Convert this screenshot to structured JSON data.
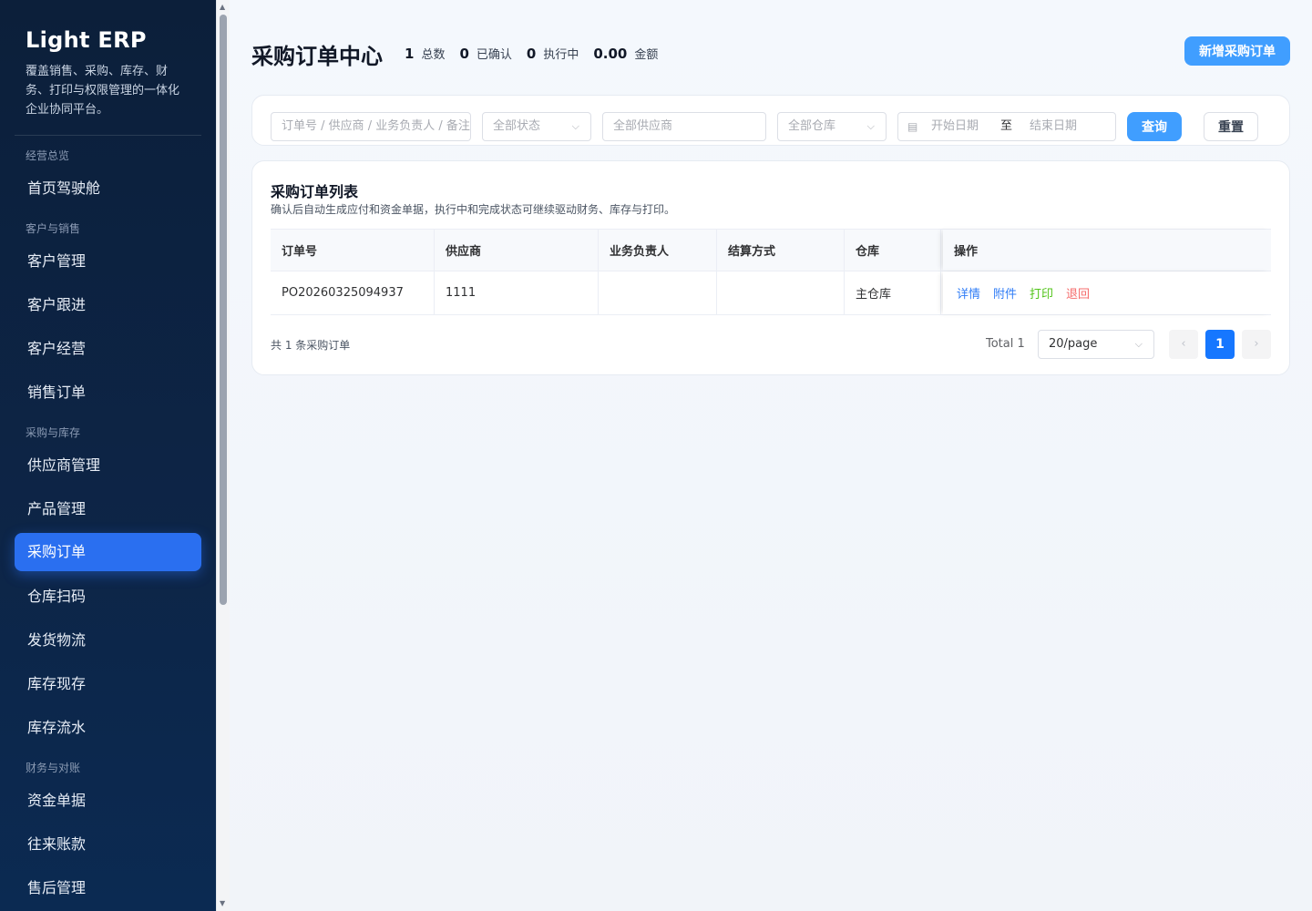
{
  "app": {
    "brand": "Light ERP",
    "description": "覆盖销售、采购、库存、财务、打印与权限管理的一体化企业协同平台。"
  },
  "sidebar": {
    "groups": [
      "经营总览",
      "客户与销售",
      "采购与库存",
      "财务与对账"
    ],
    "items": [
      {
        "label": "首页驾驶舱"
      },
      {
        "label": "客户管理"
      },
      {
        "label": "客户跟进"
      },
      {
        "label": "客户经营"
      },
      {
        "label": "销售订单"
      },
      {
        "label": "供应商管理"
      },
      {
        "label": "产品管理"
      },
      {
        "label": "采购订单",
        "active": true
      },
      {
        "label": "仓库扫码"
      },
      {
        "label": "发货物流"
      },
      {
        "label": "库存现存"
      },
      {
        "label": "库存流水"
      },
      {
        "label": "资金单据"
      },
      {
        "label": "往来账款"
      },
      {
        "label": "售后管理"
      }
    ]
  },
  "header": {
    "title": "采购订单中心",
    "stats": [
      {
        "value": "1",
        "label": "总数"
      },
      {
        "value": "0",
        "label": "已确认"
      },
      {
        "value": "0",
        "label": "执行中"
      },
      {
        "value": "0.00",
        "label": "金额"
      }
    ],
    "new_button": "新增采购订单"
  },
  "filters": {
    "keyword_placeholder": "订单号 / 供应商 / 业务负责人 / 备注",
    "status_placeholder": "全部状态",
    "supplier_placeholder": "全部供应商",
    "warehouse_placeholder": "全部仓库",
    "date_start_placeholder": "开始日期",
    "date_separator": "至",
    "date_end_placeholder": "结束日期",
    "query_button": "查询",
    "reset_button": "重置"
  },
  "list": {
    "title": "采购订单列表",
    "subtitle": "确认后自动生成应付和资金单据，执行中和完成状态可继续驱动财务、库存与打印。",
    "columns": [
      "订单号",
      "供应商",
      "业务负责人",
      "结算方式",
      "仓库",
      "操作"
    ],
    "rows": [
      {
        "order_no": "PO20260325094937",
        "supplier": "1111",
        "owner": "",
        "settlement": "",
        "warehouse": "主仓库"
      }
    ],
    "actions": [
      "详情",
      "附件",
      "打印",
      "退回"
    ],
    "total_text": "共 1 条采购订单"
  },
  "pagination": {
    "total_label": "Total 1",
    "page_size": "20/page",
    "current_page": "1"
  },
  "colors": {
    "sidebar_bg": "#0c1f3a",
    "accent": "#2a6ff0",
    "primary_button": "#409eff",
    "action_blue": "#2f7cf6",
    "action_green": "#52c41a",
    "action_red": "#f56c6c"
  }
}
